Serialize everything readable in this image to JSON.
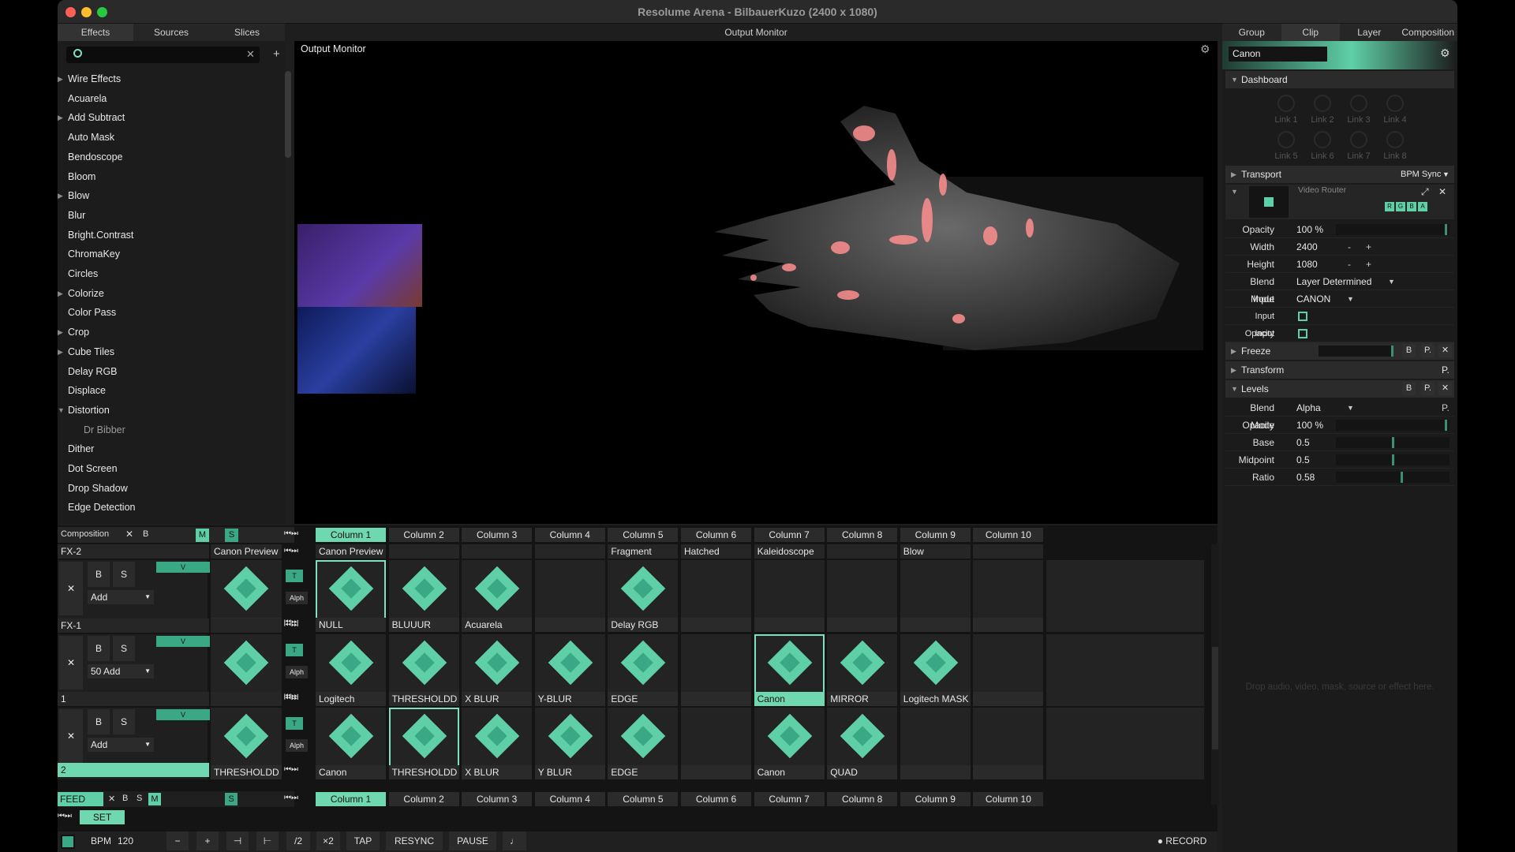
{
  "window": {
    "title": "Resolume Arena - BilbauerKuzo (2400 x 1080)"
  },
  "left_tabs": [
    "Effects",
    "Sources",
    "Slices"
  ],
  "effects": [
    {
      "label": "Wire Effects",
      "arrow": "▶"
    },
    {
      "label": "Acuarela",
      "arrow": ""
    },
    {
      "label": "Add Subtract",
      "arrow": "▶"
    },
    {
      "label": "Auto Mask",
      "arrow": ""
    },
    {
      "label": "Bendoscope",
      "arrow": ""
    },
    {
      "label": "Bloom",
      "arrow": ""
    },
    {
      "label": "Blow",
      "arrow": "▶"
    },
    {
      "label": "Blur",
      "arrow": ""
    },
    {
      "label": "Bright.Contrast",
      "arrow": ""
    },
    {
      "label": "ChromaKey",
      "arrow": ""
    },
    {
      "label": "Circles",
      "arrow": ""
    },
    {
      "label": "Colorize",
      "arrow": "▶"
    },
    {
      "label": "Color Pass",
      "arrow": ""
    },
    {
      "label": "Crop",
      "arrow": "▶"
    },
    {
      "label": "Cube Tiles",
      "arrow": "▶"
    },
    {
      "label": "Delay RGB",
      "arrow": ""
    },
    {
      "label": "Displace",
      "arrow": ""
    },
    {
      "label": "Distortion",
      "arrow": "▼"
    },
    {
      "label": "Dr Bibber",
      "arrow": "",
      "sub": true
    },
    {
      "label": "Dither",
      "arrow": ""
    },
    {
      "label": "Dot Screen",
      "arrow": ""
    },
    {
      "label": "Drop Shadow",
      "arrow": ""
    },
    {
      "label": "Edge Detection",
      "arrow": ""
    }
  ],
  "output": {
    "header": "Output Monitor",
    "title": "Output Monitor"
  },
  "right": {
    "tabs": [
      "Group",
      "Clip",
      "Layer",
      "Composition"
    ],
    "name": "Canon",
    "dashboard": "Dashboard",
    "links": [
      "Link 1",
      "Link 2",
      "Link 3",
      "Link 4",
      "Link 5",
      "Link 6",
      "Link 7",
      "Link 8"
    ],
    "transport": "Transport",
    "bpm_sync": "BPM Sync",
    "router": "Video Router",
    "rgba": [
      "R",
      "G",
      "B",
      "A"
    ],
    "opacity_l": "Opacity",
    "opacity_v": "100 %",
    "opacity_fill": 0.98,
    "width_l": "Width",
    "width_v": "2400",
    "height_l": "Height",
    "height_v": "1080",
    "blend_l": "Blend Mode",
    "blend_v": "Layer Determined",
    "input_l": "Input",
    "input_v": "CANON",
    "in_op_l": "Input Opacity",
    "in_by_l": "Input Bypass...",
    "freeze": "Freeze",
    "transform": "Transform",
    "levels": "Levels",
    "lv_blend_l": "Blend Mode",
    "lv_blend_v": "Alpha",
    "lv_opacity_l": "Opacity",
    "lv_opacity_v": "100 %",
    "lv_opacity_fill": 0.98,
    "base_l": "Base",
    "base_v": "0.5",
    "base_fill": 0.5,
    "mid_l": "Midpoint",
    "mid_v": "0.5",
    "mid_fill": 0.5,
    "ratio_l": "Ratio",
    "ratio_v": "0.58",
    "ratio_fill": 0.58,
    "drop_hint": "Drop audio, video, mask, source or effect here."
  },
  "comp": {
    "label": "Composition",
    "b": "B",
    "m": "M",
    "s": "S"
  },
  "columns": [
    "Column 1",
    "Column 2",
    "Column 3",
    "Column 4",
    "Column 5",
    "Column 6",
    "Column 7",
    "Column 8",
    "Column 9",
    "Column 10"
  ],
  "layers": [
    {
      "fxname": "FX-2",
      "preview": "Canon Preview",
      "blend": "Add",
      "thumb": "NULL",
      "headers": [
        "Canon Preview",
        "",
        "",
        "",
        "Fragment",
        "Hatched",
        "Kaleidoscope",
        "",
        "Blow",
        ""
      ],
      "clips": [
        "NULL",
        "BLUUUR",
        "Acuarela",
        "",
        "Delay RGB",
        "",
        "",
        "",
        "",
        ""
      ]
    },
    {
      "fxname": "FX-1",
      "preview": "",
      "blend": "50 Add",
      "thumb": "Canon",
      "headers": [],
      "clips": [
        "Logitech",
        "THRESHOLDD",
        "X BLUR",
        "Y-BLUR",
        "EDGE",
        "",
        "Canon",
        "MIRROR",
        "Logitech MASK",
        ""
      ]
    },
    {
      "fxname": "1",
      "preview": "",
      "blend": "Add",
      "thumb": "THRESHOLDD",
      "headers": [],
      "clips": [
        "Canon",
        "THRESHOLDD",
        "X BLUR",
        "Y BLUR",
        "EDGE",
        "",
        "Canon",
        "QUAD",
        "",
        ""
      ]
    }
  ],
  "layer3_name": "2",
  "deck": {
    "name": "FEED",
    "set": "SET"
  },
  "bottom": {
    "bpm_label": "BPM",
    "bpm": "120",
    "minus": "−",
    "plus": "+",
    "half": "/2",
    "double": "×2",
    "tap": "TAP",
    "resync": "RESYNC",
    "pause": "PAUSE",
    "record": "RECORD"
  }
}
